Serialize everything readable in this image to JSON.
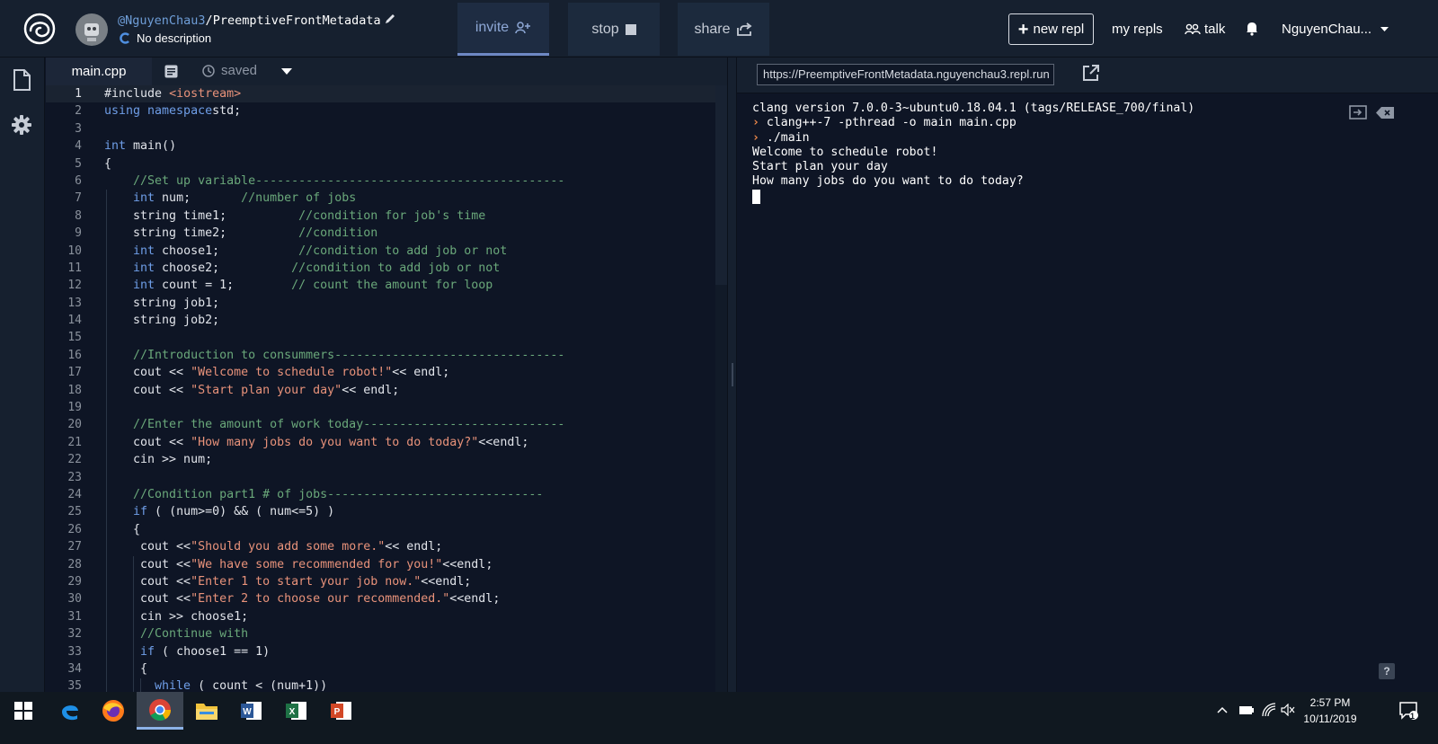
{
  "header": {
    "owner": "@NguyenChau3",
    "separator": "/",
    "repl_name": "PreemptiveFrontMetadata",
    "description": "No description",
    "invite_label": "invite",
    "stop_label": "stop",
    "share_label": "share",
    "new_repl_label": "new repl",
    "my_repls_label": "my repls",
    "talk_label": "talk",
    "username": "NguyenChau..."
  },
  "editor": {
    "file_tab": "main.cpp",
    "saved_label": "saved",
    "active_line": 1,
    "line_numbers": [
      "1",
      "2",
      "3",
      "4",
      "5",
      "6",
      "7",
      "8",
      "9",
      "10",
      "11",
      "12",
      "13",
      "14",
      "15",
      "16",
      "17",
      "18",
      "19",
      "20",
      "21",
      "22",
      "23",
      "24",
      "25",
      "26",
      "27",
      "28",
      "29",
      "30",
      "31",
      "32",
      "33",
      "34",
      "35"
    ],
    "lines": [
      [
        [
          "inc",
          "#include "
        ],
        [
          "str",
          "<iostream>"
        ]
      ],
      [
        [
          "kw",
          "using namespace"
        ],
        [
          "",
          "std;"
        ]
      ],
      [],
      [
        [
          "kw",
          "int"
        ],
        [
          "",
          " main()"
        ]
      ],
      [
        [
          "",
          "{"
        ]
      ],
      [
        [
          "cm",
          "    //Set up variable-------------------------------------------"
        ]
      ],
      [
        [
          "kw",
          "    int"
        ],
        [
          "",
          " num;       "
        ],
        [
          "cm",
          "//number of jobs"
        ]
      ],
      [
        [
          "",
          "    string time1;          "
        ],
        [
          "cm",
          "//condition for job's time"
        ]
      ],
      [
        [
          "",
          "    string time2;          "
        ],
        [
          "cm",
          "//condition"
        ]
      ],
      [
        [
          "kw",
          "    int"
        ],
        [
          "",
          " choose1;           "
        ],
        [
          "cm",
          "//condition to add job or not"
        ]
      ],
      [
        [
          "kw",
          "    int"
        ],
        [
          "",
          " choose2;          "
        ],
        [
          "cm",
          "//condition to add job or not"
        ]
      ],
      [
        [
          "kw",
          "    int"
        ],
        [
          "",
          " count = 1;        "
        ],
        [
          "cm",
          "// count the amount for loop"
        ]
      ],
      [
        [
          "",
          "    string job1;"
        ]
      ],
      [
        [
          "",
          "    string job2;"
        ]
      ],
      [],
      [
        [
          "cm",
          "    //Introduction to consummers--------------------------------"
        ]
      ],
      [
        [
          "",
          "    cout << "
        ],
        [
          "str",
          "\"Welcome to schedule robot!\""
        ],
        [
          "",
          "<< endl;"
        ]
      ],
      [
        [
          "",
          "    cout << "
        ],
        [
          "str",
          "\"Start plan your day\""
        ],
        [
          "",
          "<< endl;"
        ]
      ],
      [],
      [
        [
          "cm",
          "    //Enter the amount of work today----------------------------"
        ]
      ],
      [
        [
          "",
          "    cout << "
        ],
        [
          "str",
          "\"How many jobs do you want to do today?\""
        ],
        [
          "",
          "<<endl;"
        ]
      ],
      [
        [
          "",
          "    cin >> num;"
        ]
      ],
      [],
      [
        [
          "cm",
          "    //Condition part1 # of jobs------------------------------"
        ]
      ],
      [
        [
          "kw",
          "    if"
        ],
        [
          "",
          " ( (num>=0) && ( num<=5) )"
        ]
      ],
      [
        [
          "",
          "    {"
        ]
      ],
      [
        [
          "",
          "     cout <<"
        ],
        [
          "str",
          "\"Should you add some more.\""
        ],
        [
          "",
          "<< endl;"
        ]
      ],
      [
        [
          "",
          "     cout <<"
        ],
        [
          "str",
          "\"We have some recommended for you!\""
        ],
        [
          "",
          "<<endl;"
        ]
      ],
      [
        [
          "",
          "     cout <<"
        ],
        [
          "str",
          "\"Enter 1 to start your job now.\""
        ],
        [
          "",
          "<<endl;"
        ]
      ],
      [
        [
          "",
          "     cout <<"
        ],
        [
          "str",
          "\"Enter 2 to choose our recommended.\""
        ],
        [
          "",
          "<<endl;"
        ]
      ],
      [
        [
          "",
          "     cin >> choose1;"
        ]
      ],
      [
        [
          "cm",
          "     //Continue with"
        ]
      ],
      [
        [
          "kw",
          "     if"
        ],
        [
          "",
          " ( choose1 == 1)"
        ]
      ],
      [
        [
          "",
          "     {"
        ]
      ],
      [
        [
          "kw",
          "       while"
        ],
        [
          "",
          " ( count < (num+1))"
        ]
      ]
    ]
  },
  "console": {
    "url": "https://PreemptiveFrontMetadata.nguyenchau3.repl.run",
    "lines": [
      {
        "prompt": "",
        "text": "clang version 7.0.0-3~ubuntu0.18.04.1 (tags/RELEASE_700/final)"
      },
      {
        "prompt": "› ",
        "text": "clang++-7 -pthread -o main main.cpp"
      },
      {
        "prompt": "› ",
        "text": "./main"
      },
      {
        "prompt": "",
        "text": "Welcome to schedule robot!"
      },
      {
        "prompt": "",
        "text": "Start plan your day"
      },
      {
        "prompt": "",
        "text": "How many jobs do you want to do today?"
      }
    ],
    "help_label": "?"
  },
  "taskbar": {
    "apps": [
      "windows-start-icon",
      "edge-icon",
      "firefox-icon",
      "chrome-icon",
      "file-explorer-icon",
      "word-icon",
      "excel-icon",
      "powerpoint-icon"
    ],
    "time": "2:57 PM",
    "date": "10/11/2019",
    "notification_count": "1"
  },
  "colors": {
    "background": "#0e1525",
    "panel": "#16202f",
    "keyword": "#6f9ee8",
    "string": "#e8927a",
    "comment": "#6aa87a",
    "prompt": "#f08a4b"
  }
}
